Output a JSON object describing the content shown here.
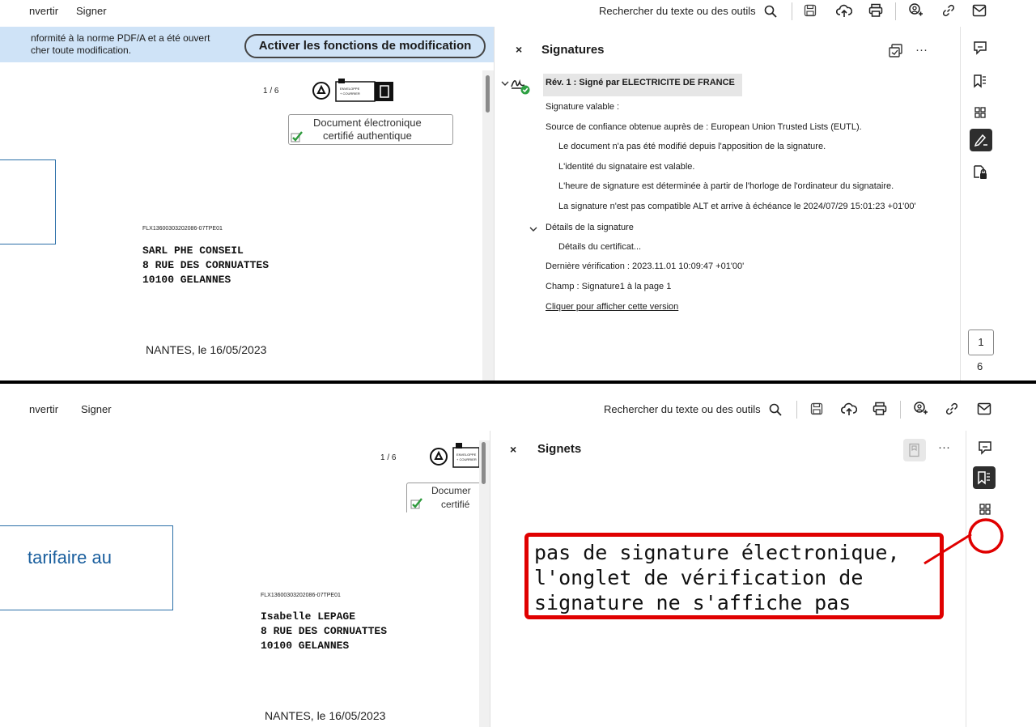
{
  "top": {
    "menu": {
      "convert": "nvertir",
      "sign": "Signer"
    },
    "search": "Rechercher du texte ou des outils",
    "banner": {
      "text_line1": "nformité à la norme PDF/A et a été ouvert",
      "text_line2": "cher toute modification.",
      "button": "Activer les fonctions de modification"
    },
    "doc": {
      "page_indicator": "1 / 6",
      "stamp_line1": "Document électronique",
      "stamp_line2": "certifié authentique",
      "reference": "FLX13600303202086-07TPE01",
      "address": [
        "SARL PHE CONSEIL",
        "8 RUE DES CORNUATTES",
        "10100 GELANNES"
      ],
      "city_date": "NANTES, le 16/05/2023"
    },
    "panel": {
      "title": "Signatures",
      "more": "···",
      "rev": "Rév. 1 : Signé par ELECTRICITE DE FRANCE",
      "lines": [
        "Signature valable :",
        "Source de confiance obtenue auprès de : European Union Trusted Lists (EUTL).",
        "Le document n'a pas été modifié depuis l'apposition de la signature.",
        "L'identité du signataire est valable.",
        "L'heure de signature est déterminée à partir de l'horloge de l'ordinateur du signataire.",
        "La signature n'est pas compatible ALT et arrive à échéance le 2024/07/29 15:01:23 +01'00'"
      ],
      "details": "Détails de la signature",
      "cert": "Détails du certificat...",
      "last_check": "Dernière vérification : 2023.11.01 10:09:47 +01'00'",
      "field": "Champ : Signature1 à la page 1",
      "link": "Cliquer pour afficher cette version"
    },
    "page_number": "1",
    "page_total": "6"
  },
  "bottom": {
    "menu": {
      "convert": "nvertir",
      "sign": "Signer"
    },
    "search": "Rechercher du texte ou des outils",
    "doc": {
      "page_indicator": "1 / 6",
      "stamp_line1": "Documer",
      "stamp_line2": "certifié",
      "box_text": "tarifaire au",
      "reference": "FLX13600303202086-07TPE01",
      "address": [
        "Isabelle LEPAGE",
        "8 RUE DES CORNUATTES",
        "10100 GELANNES"
      ],
      "city_date": "NANTES, le 16/05/2023"
    },
    "panel": {
      "title": "Signets",
      "more": "···"
    },
    "annotation": [
      "pas de signature électronique,",
      "l'onglet de vérification de",
      "signature ne s'affiche pas"
    ]
  },
  "colors": {
    "banner_bg": "#cfe3f7",
    "annotation_red": "#e00000",
    "sig_green": "#2ea043",
    "rev_bg": "#e6e6e6",
    "link_blue": "#1b5fb8"
  }
}
